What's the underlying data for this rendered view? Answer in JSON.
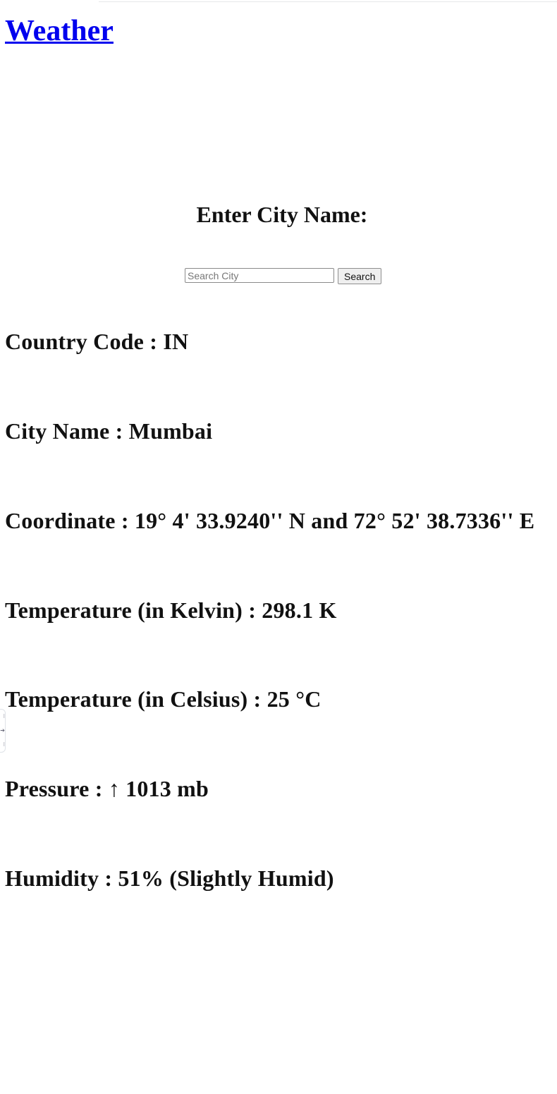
{
  "header": {
    "title": "Weather"
  },
  "search": {
    "prompt": "Enter City Name:",
    "placeholder": "Search City",
    "value": "",
    "button_label": "Search"
  },
  "results": [
    "Country Code : IN",
    "City Name : Mumbai",
    "Coordinate : 19° 4' 33.9240'' N and 72° 52' 38.7336'' E",
    "Temperature (in Kelvin) : 298.1 K",
    "Temperature (in Celsius) : 25 °C",
    "Pressure : ↑ 1013 mb",
    "Humidity : 51% (Slightly Humid)"
  ]
}
